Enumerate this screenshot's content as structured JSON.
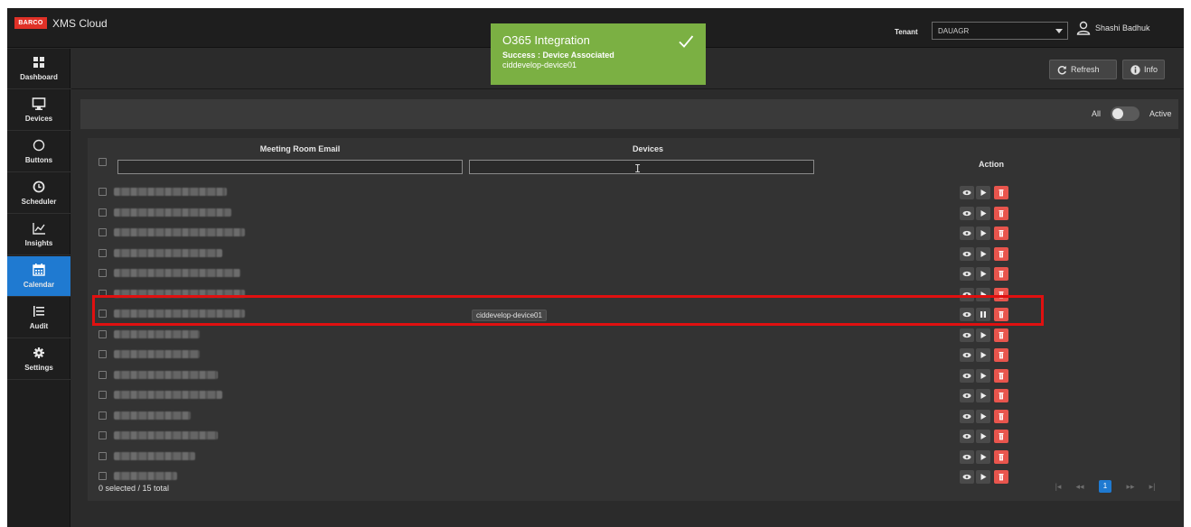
{
  "app": {
    "logo_text": "BARCO",
    "title": "XMS Cloud"
  },
  "header": {
    "tenant_label": "Tenant",
    "tenant_value": "DAUAGR",
    "user_name": "Shashi Badhuk"
  },
  "sidebar": {
    "items": [
      {
        "label": "Dashboard",
        "icon": "dashboard-icon",
        "active": false
      },
      {
        "label": "Devices",
        "icon": "monitor-icon",
        "active": false
      },
      {
        "label": "Buttons",
        "icon": "circle-icon",
        "active": false
      },
      {
        "label": "Scheduler",
        "icon": "clock-icon",
        "active": false
      },
      {
        "label": "Insights",
        "icon": "chart-icon",
        "active": false
      },
      {
        "label": "Calendar",
        "icon": "calendar-icon",
        "active": true
      },
      {
        "label": "Audit",
        "icon": "list-icon",
        "active": false
      },
      {
        "label": "Settings",
        "icon": "gear-icon",
        "active": false
      }
    ]
  },
  "toolbar": {
    "refresh_label": "Refresh",
    "info_label": "Info"
  },
  "filter": {
    "all_label": "All",
    "active_label": "Active"
  },
  "table": {
    "col_email": "Meeting Room Email",
    "col_devices": "Devices",
    "col_action": "Action",
    "email_filter_value": "",
    "devices_filter_value": "",
    "rows": [
      {
        "device": "",
        "playing": false
      },
      {
        "device": "",
        "playing": false
      },
      {
        "device": "",
        "playing": false
      },
      {
        "device": "",
        "playing": false
      },
      {
        "device": "",
        "playing": false
      },
      {
        "device": "",
        "playing": false
      },
      {
        "device": "ciddevelop-device01",
        "playing": true
      },
      {
        "device": "",
        "playing": false
      },
      {
        "device": "",
        "playing": false
      },
      {
        "device": "",
        "playing": false
      },
      {
        "device": "",
        "playing": false
      },
      {
        "device": "",
        "playing": false
      },
      {
        "device": "",
        "playing": false
      },
      {
        "device": "",
        "playing": false
      },
      {
        "device": "",
        "playing": false
      }
    ],
    "footer_count": "0 selected / 15 total",
    "current_page": "1"
  },
  "toast": {
    "title": "O365 Integration",
    "message": "Success : Device Associated",
    "device": "ciddevelop-device01"
  },
  "colors": {
    "accent": "#1f7ad1",
    "toast_success": "#7bb043",
    "delete": "#e8554d",
    "highlight": "#e01010"
  }
}
